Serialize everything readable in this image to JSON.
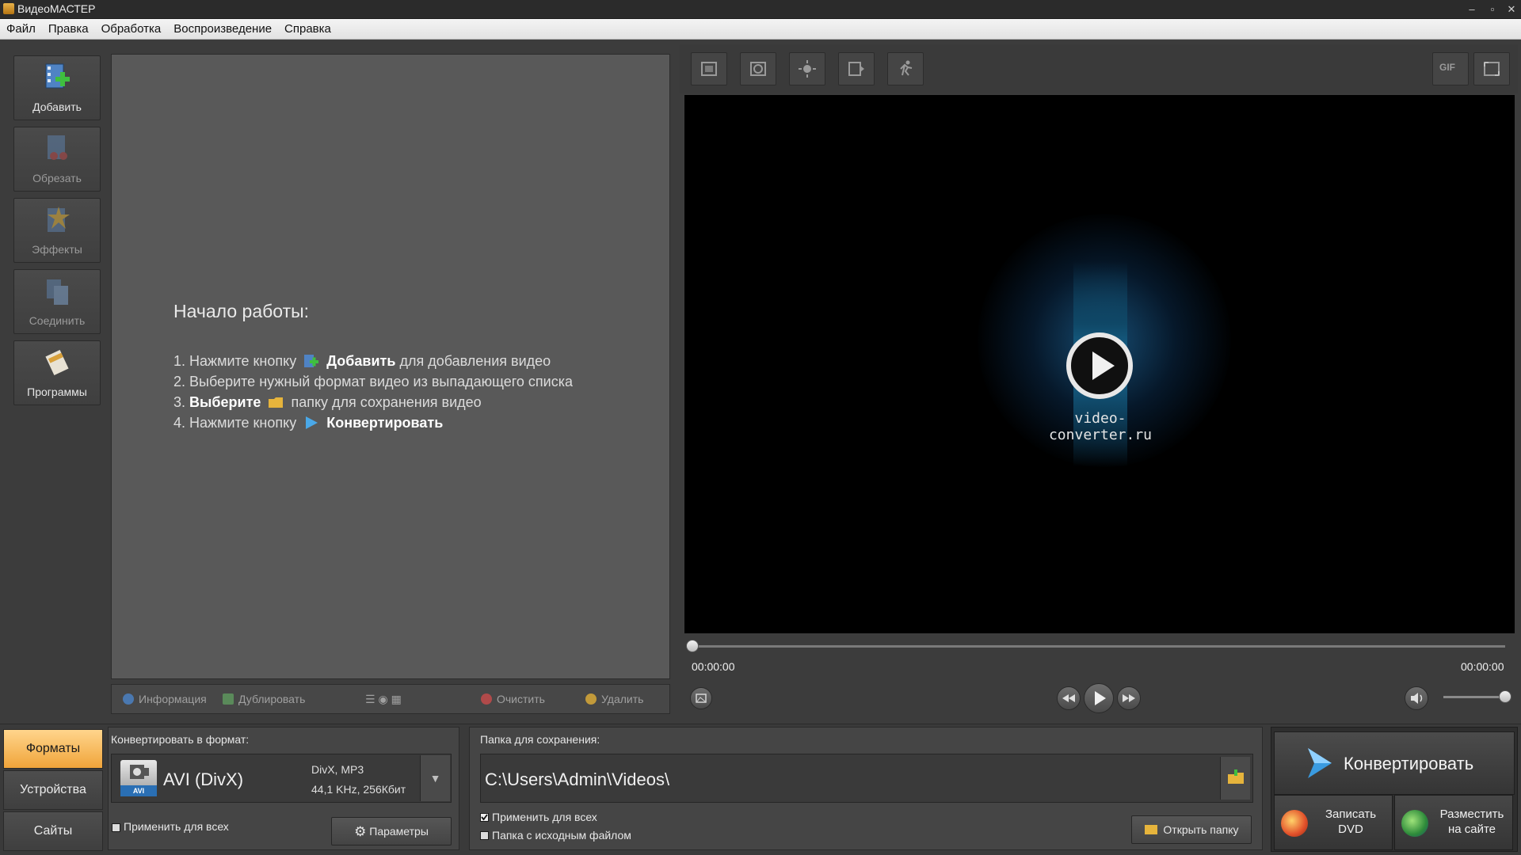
{
  "app": {
    "title": "ВидеоМАСТЕР"
  },
  "menu": [
    "Файл",
    "Правка",
    "Обработка",
    "Воспроизведение",
    "Справка"
  ],
  "sidebar": {
    "add": "Добавить",
    "cut": "Обрезать",
    "effects": "Эффекты",
    "join": "Соединить",
    "programs": "Программы"
  },
  "getting_started": {
    "title": "Начало работы:",
    "step1_a": "1. Нажмите кнопку",
    "step1_b": "Добавить",
    "step1_c": "для добавления видео",
    "step2": "2. Выберите нужный формат видео из выпадающего списка",
    "step3_a": "3.",
    "step3_b": "Выберите",
    "step3_c": "папку для сохранения видео",
    "step4_a": "4. Нажмите кнопку",
    "step4_b": "Конвертировать"
  },
  "list_toolbar": {
    "info": "Информация",
    "duplicate": "Дублировать",
    "clear": "Очистить",
    "delete": "Удалить"
  },
  "preview": {
    "brand": "video-converter.ru",
    "time_current": "00:00:00",
    "time_total": "00:00:00",
    "gif_label": "GIF"
  },
  "tabs": [
    "Форматы",
    "Устройства",
    "Сайты"
  ],
  "format": {
    "label": "Конвертировать в формат:",
    "name": "AVI (DivX)",
    "icon_text": "AVI",
    "detail1": "DivX, MP3",
    "detail2": "44,1 KHz, 256Кбит",
    "apply_all": "Применить для всех",
    "params": "Параметры"
  },
  "save": {
    "label": "Папка для сохранения:",
    "path": "C:\\Users\\Admin\\Videos\\",
    "apply_all": "Применить для всех",
    "source_folder": "Папка с исходным файлом",
    "open_folder": "Открыть папку"
  },
  "convert": {
    "main": "Конвертировать",
    "dvd_1": "Записать",
    "dvd_2": "DVD",
    "web_1": "Разместить",
    "web_2": "на сайте"
  },
  "colors": {
    "accent_tab": "#f0a43a",
    "video_bg": "#000000",
    "panel": "#595959"
  }
}
